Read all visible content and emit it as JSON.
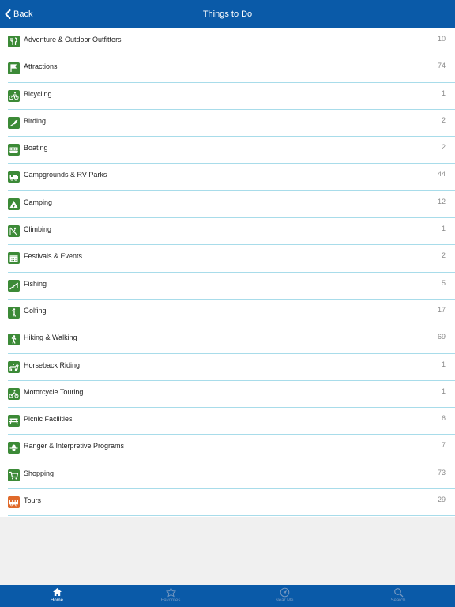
{
  "nav": {
    "back_label": "Back",
    "title": "Things to Do"
  },
  "items": [
    {
      "label": "Adventure & Outdoor Outfitters",
      "count": "10",
      "icon": "outfitters-icon",
      "color": "#3c8a37"
    },
    {
      "label": "Attractions",
      "count": "74",
      "icon": "flag-icon",
      "color": "#3c8a37"
    },
    {
      "label": "Bicycling",
      "count": "1",
      "icon": "bicycle-icon",
      "color": "#3c8a37"
    },
    {
      "label": "Birding",
      "count": "2",
      "icon": "bird-icon",
      "color": "#3c8a37"
    },
    {
      "label": "Boating",
      "count": "2",
      "icon": "boat-icon",
      "color": "#3c8a37"
    },
    {
      "label": "Campgrounds & RV Parks",
      "count": "44",
      "icon": "rv-icon",
      "color": "#3c8a37"
    },
    {
      "label": "Camping",
      "count": "12",
      "icon": "tent-icon",
      "color": "#3c8a37"
    },
    {
      "label": "Climbing",
      "count": "1",
      "icon": "climbing-icon",
      "color": "#3c8a37"
    },
    {
      "label": "Festivals & Events",
      "count": "2",
      "icon": "calendar-icon",
      "color": "#3c8a37"
    },
    {
      "label": "Fishing",
      "count": "5",
      "icon": "fishing-icon",
      "color": "#3c8a37"
    },
    {
      "label": "Golfing",
      "count": "17",
      "icon": "golf-icon",
      "color": "#3c8a37"
    },
    {
      "label": "Hiking & Walking",
      "count": "69",
      "icon": "hiking-icon",
      "color": "#3c8a37"
    },
    {
      "label": "Horseback Riding",
      "count": "1",
      "icon": "horse-icon",
      "color": "#3c8a37"
    },
    {
      "label": "Motorcycle Touring",
      "count": "1",
      "icon": "motorcycle-icon",
      "color": "#3c8a37"
    },
    {
      "label": "Picnic Facilities",
      "count": "6",
      "icon": "picnic-table-icon",
      "color": "#3c8a37"
    },
    {
      "label": "Ranger & Interpretive Programs",
      "count": "7",
      "icon": "ranger-icon",
      "color": "#3c8a37"
    },
    {
      "label": "Shopping",
      "count": "73",
      "icon": "shopping-cart-icon",
      "color": "#3c8a37"
    },
    {
      "label": "Tours",
      "count": "29",
      "icon": "tour-bus-icon",
      "color": "#e06a2b"
    }
  ],
  "tabs": [
    {
      "label": "Home",
      "icon": "home-icon",
      "active": true
    },
    {
      "label": "Favorites",
      "icon": "star-icon",
      "active": false
    },
    {
      "label": "Near Me",
      "icon": "location-arrow-icon",
      "active": false
    },
    {
      "label": "Search",
      "icon": "search-icon",
      "active": false
    }
  ],
  "colors": {
    "brand": "#0a5aa8",
    "icon_green": "#3c8a37",
    "icon_orange": "#e06a2b",
    "separator": "#a8dcea"
  }
}
